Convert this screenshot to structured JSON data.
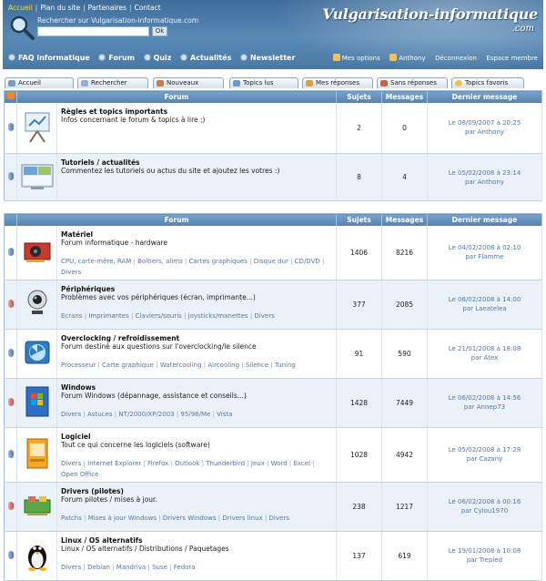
{
  "header": {
    "top_nav": [
      {
        "label": "Accueil",
        "active": true
      },
      {
        "label": "Plan du site",
        "active": false
      },
      {
        "label": "Partenaires",
        "active": false
      },
      {
        "label": "Contact",
        "active": false
      }
    ],
    "search_label": "Rechercher sur Vulgarisation-informatique.com",
    "search_value": "",
    "search_button": "Ok",
    "logo_text": "Vulgarisation-informatique",
    "logo_suffix": ".com",
    "main_nav": [
      {
        "label": "FAQ informatique",
        "icon": "faq-icon"
      },
      {
        "label": "Forum",
        "icon": "forum-icon"
      },
      {
        "label": "Quiz",
        "icon": "quiz-icon"
      },
      {
        "label": "Actualités",
        "icon": "news-icon"
      },
      {
        "label": "Newsletter",
        "icon": "newsletter-icon"
      }
    ],
    "user_nav": [
      {
        "label": "Mes options",
        "icon": "options-icon"
      },
      {
        "label": "Anthony",
        "icon": "user-icon"
      },
      {
        "label": "Déconnexion",
        "icon": "logout-icon"
      },
      {
        "label": "Espace membre",
        "icon": "member-icon"
      }
    ]
  },
  "tabs": [
    {
      "label": "Accueil",
      "icon": "home-icon"
    },
    {
      "label": "Rechercher",
      "icon": "search-icon"
    },
    {
      "label": "Nouveaux",
      "icon": "new-icon"
    },
    {
      "label": "Topics lus",
      "icon": "read-icon"
    },
    {
      "label": "Mes réponses",
      "icon": "my-replies-icon"
    },
    {
      "label": "Sans réponses",
      "icon": "no-reply-icon"
    },
    {
      "label": "Topics favoris",
      "icon": "star-icon"
    }
  ],
  "table_headers": {
    "forum": "Forum",
    "topics": "Sujets",
    "messages": "Messages",
    "last": "Dernier message"
  },
  "top_forums": [
    {
      "title": "Règles et topics importants",
      "desc": "Infos concernant le forum & topics à lire ;)",
      "topics": "2",
      "messages": "0",
      "last_date": "Le 08/09/2007 à 20:25",
      "last_user": "par Anthony",
      "icon": "presentation-board-icon",
      "status_color": "#4f78b8"
    },
    {
      "title": "Tutoriels / actualités",
      "desc": "Commentez les tutoriels ou actus du site et ajoutez les votres :)",
      "topics": "8",
      "messages": "4",
      "last_date": "Le 05/02/2008 à 23:14",
      "last_user": "par Anthony",
      "icon": "windows-screen-icon",
      "status_color": "#4f78b8"
    }
  ],
  "forums": [
    {
      "title": "Matériel",
      "desc": "Forum informatique - hardware",
      "subs": [
        "CPU, carte-mère, RAM",
        "Boîtiers, alims",
        "Cartes graphiques",
        "Disque dur",
        "CD/DVD",
        "Divers"
      ],
      "topics": "1406",
      "messages": "8216",
      "last_date": "Le 04/02/2008 à 02:10",
      "last_user": "par Flamme",
      "icon": "graphics-card-icon",
      "status_color": "#4f78b8"
    },
    {
      "title": "Périphériques",
      "desc": "Problèmes avec vos périphériques (écran, imprimante...)",
      "subs": [
        "Ecrans",
        "Imprimantes",
        "Claviers/souris",
        "joysticks/manettes",
        "Divers"
      ],
      "topics": "377",
      "messages": "2085",
      "last_date": "Le 06/02/2008 à 14:00",
      "last_user": "par Laeatelea",
      "icon": "webcam-icon",
      "status_color": "#c64c4c"
    },
    {
      "title": "Overclocking / refroidissement",
      "desc": "Forum destiné aux questions sur l'overclocking/le silence",
      "subs": [
        "Processeur",
        "Carte graphique",
        "Watercooling",
        "Aircooling",
        "Silence",
        "Tuning"
      ],
      "topics": "91",
      "messages": "590",
      "last_date": "Le 21/01/2008 à 18:08",
      "last_user": "par Atex",
      "icon": "cooling-fan-icon",
      "status_color": "#4f78b8"
    },
    {
      "title": "Windows",
      "desc": "Forum Windows (dépannage, assistance et conseils...)",
      "subs": [
        "Divers",
        "Astuces",
        "NT/2000/XP/2003",
        "95/98/Me",
        "Vista"
      ],
      "topics": "1428",
      "messages": "7449",
      "last_date": "Le 06/02/2008 à 14:56",
      "last_user": "par Annep73",
      "icon": "windows-box-icon",
      "status_color": "#c64c4c"
    },
    {
      "title": "Logiciel",
      "desc": "Tout ce qui concerne les logiciels (software)",
      "subs": [
        "Divers",
        "Internet Explorer",
        "Firefox",
        "Outlook",
        "Thunderbird",
        "Jeux",
        "Word",
        "Excel",
        "Open Office"
      ],
      "topics": "1028",
      "messages": "4942",
      "last_date": "Le 05/02/2008 à 17:28",
      "last_user": "par Cazany",
      "icon": "software-box-icon",
      "status_color": "#4f78b8"
    },
    {
      "title": "Drivers (pilotes)",
      "desc": "Forum pilotes / mises à jour.",
      "subs": [
        "Patchs",
        "Mises à jour Windows",
        "Drivers Windows",
        "Drivers linux",
        "Divers"
      ],
      "topics": "238",
      "messages": "1217",
      "last_date": "Le 06/02/2008 à 00:16",
      "last_user": "par Cylou1970",
      "icon": "drivers-icon",
      "status_color": "#c64c4c"
    },
    {
      "title": "Linux / OS alternatifs",
      "desc": "Linux / OS alternatifs / Distributions / Paquetages",
      "subs": [
        "Divers",
        "Debian",
        "Mandriva",
        "Suse",
        "Fedora"
      ],
      "topics": "137",
      "messages": "619",
      "last_date": "Le 19/01/2008 à 10:08",
      "last_user": "par Trepied",
      "icon": "tux-penguin-icon",
      "status_color": "#4f78b8"
    }
  ]
}
